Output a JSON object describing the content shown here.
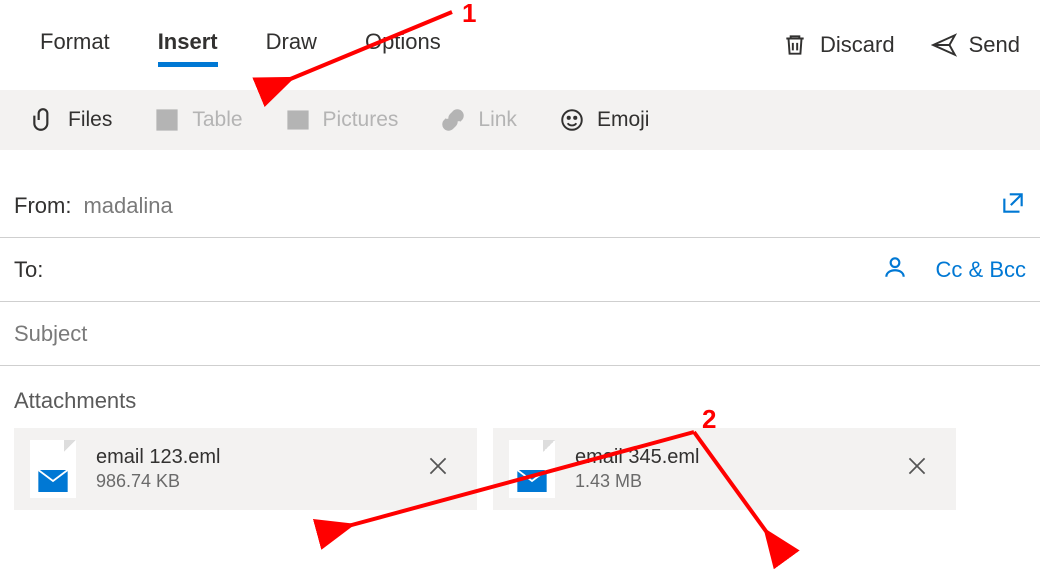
{
  "tabs": {
    "format": "Format",
    "insert": "Insert",
    "draw": "Draw",
    "options": "Options"
  },
  "topActions": {
    "discard": "Discard",
    "send": "Send"
  },
  "ribbon": {
    "files": "Files",
    "table": "Table",
    "pictures": "Pictures",
    "link": "Link",
    "emoji": "Emoji"
  },
  "fields": {
    "from_label": "From:",
    "from_value": "madalina",
    "to_label": "To:",
    "ccbcc": "Cc & Bcc",
    "subject_placeholder": "Subject",
    "attachments_label": "Attachments"
  },
  "attachments": [
    {
      "name": "email 123.eml",
      "size": "986.74 KB"
    },
    {
      "name": "email 345.eml",
      "size": "1.43 MB"
    }
  ],
  "annotations": {
    "one": "1",
    "two": "2"
  }
}
